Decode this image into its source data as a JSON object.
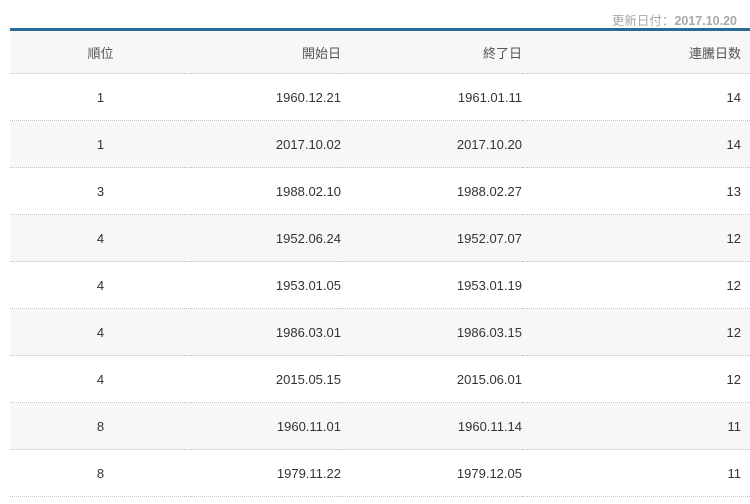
{
  "update": {
    "label": "更新日付：",
    "date": "2017.10.20"
  },
  "table": {
    "headers": {
      "rank": "順位",
      "start": "開始日",
      "end": "終了日",
      "days": "連騰日数"
    },
    "rows": [
      {
        "rank": "1",
        "start": "1960.12.21",
        "end": "1961.01.11",
        "days": "14"
      },
      {
        "rank": "1",
        "start": "2017.10.02",
        "end": "2017.10.20",
        "days": "14"
      },
      {
        "rank": "3",
        "start": "1988.02.10",
        "end": "1988.02.27",
        "days": "13"
      },
      {
        "rank": "4",
        "start": "1952.06.24",
        "end": "1952.07.07",
        "days": "12"
      },
      {
        "rank": "4",
        "start": "1953.01.05",
        "end": "1953.01.19",
        "days": "12"
      },
      {
        "rank": "4",
        "start": "1986.03.01",
        "end": "1986.03.15",
        "days": "12"
      },
      {
        "rank": "4",
        "start": "2015.05.15",
        "end": "2015.06.01",
        "days": "12"
      },
      {
        "rank": "8",
        "start": "1960.11.01",
        "end": "1960.11.14",
        "days": "11"
      },
      {
        "rank": "8",
        "start": "1979.11.22",
        "end": "1979.12.05",
        "days": "11"
      }
    ]
  }
}
